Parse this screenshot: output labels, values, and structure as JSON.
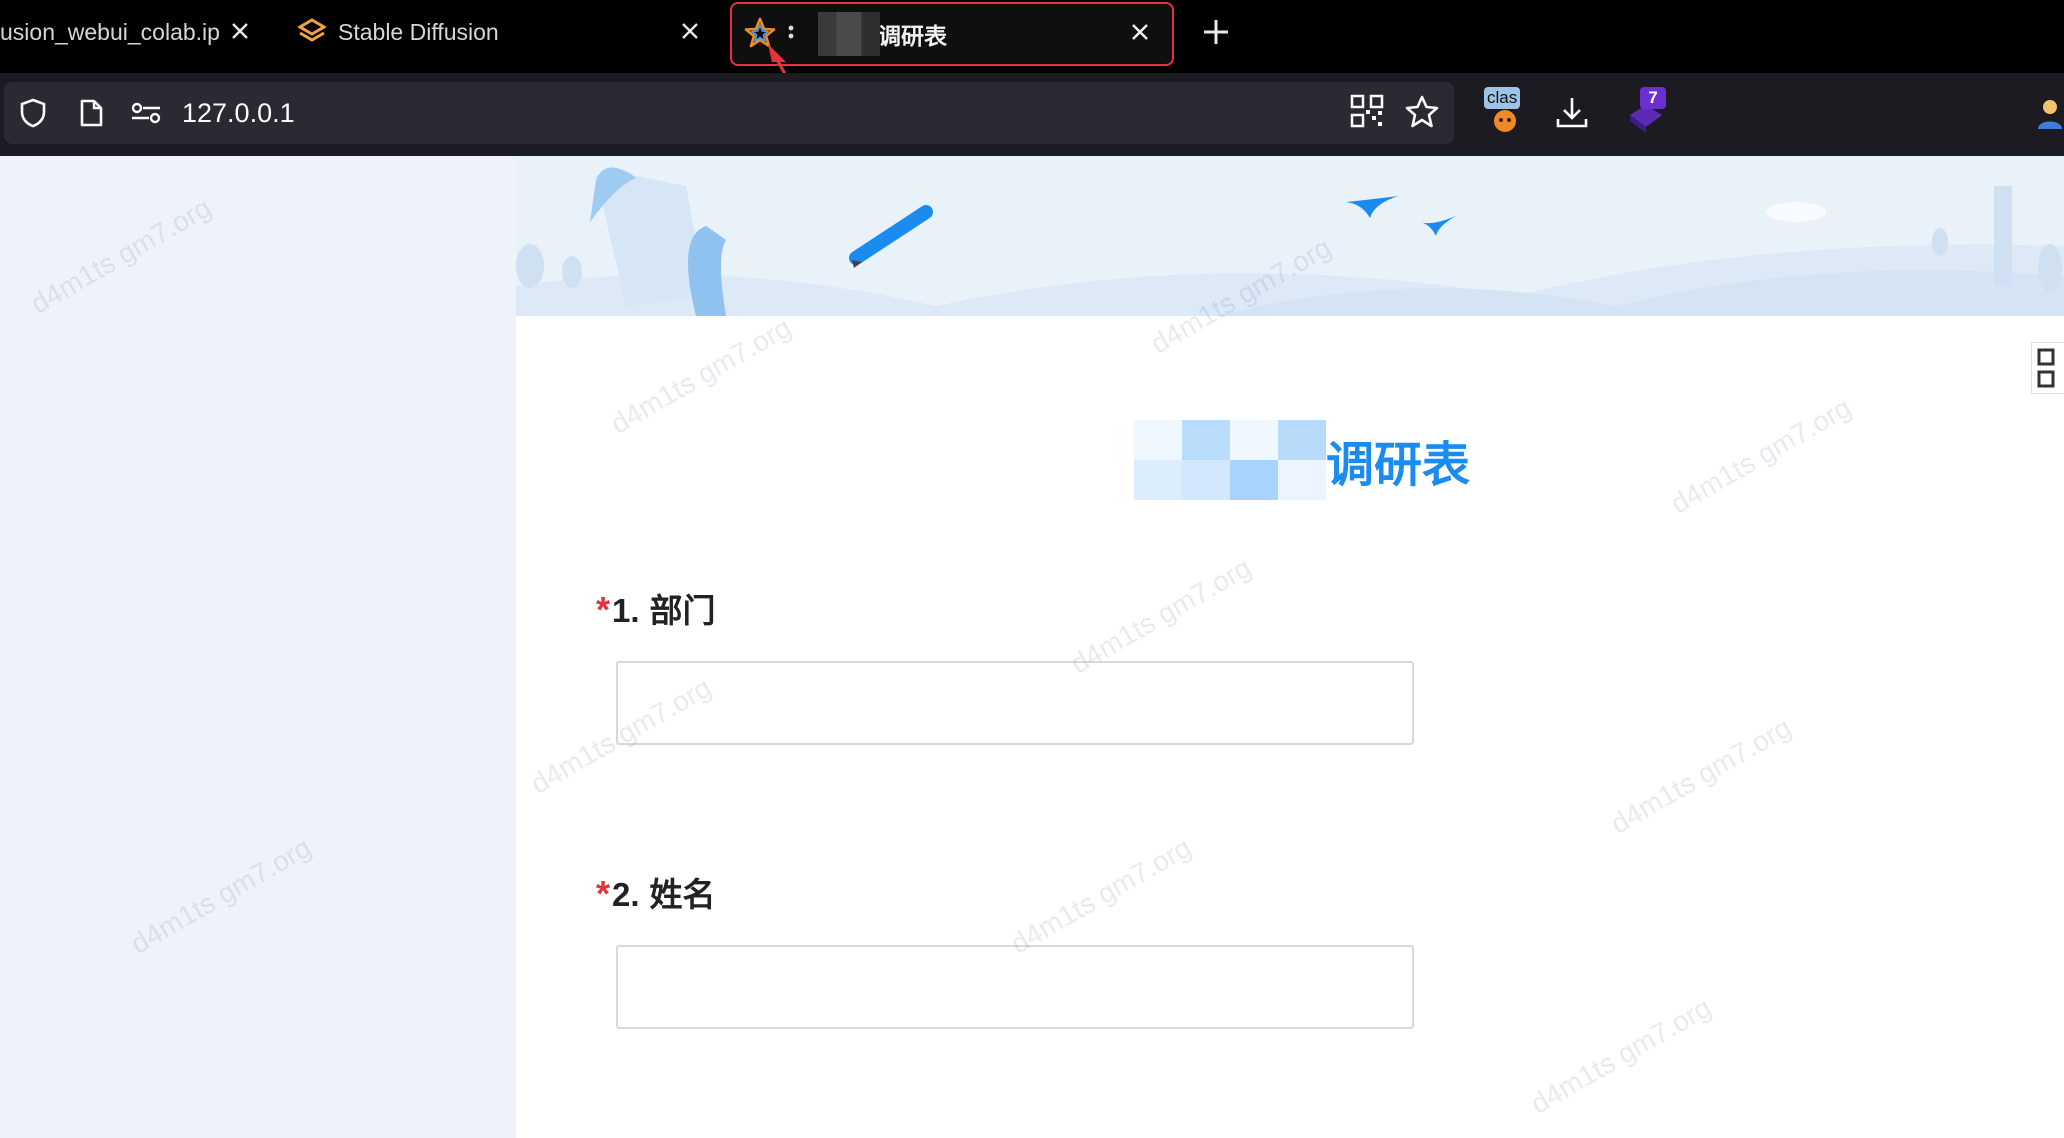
{
  "browser": {
    "tabs": [
      {
        "title": "usion_webui_colab.ip",
        "active": false
      },
      {
        "title": "Stable Diffusion",
        "active": false
      },
      {
        "title": "调研表",
        "active": true
      }
    ],
    "url": "127.0.0.1",
    "extensions": {
      "clas_label": "clas",
      "badge_count": "7"
    },
    "accent_color": "#e5323c"
  },
  "survey": {
    "title": "调研表",
    "title_color": "#1a8cf0",
    "questions": [
      {
        "number": "1.",
        "label": "部门",
        "required_mark": "*",
        "value": ""
      },
      {
        "number": "2.",
        "label": "姓名",
        "required_mark": "*",
        "value": ""
      }
    ]
  },
  "watermark_text": "d4m1ts gm7.org"
}
